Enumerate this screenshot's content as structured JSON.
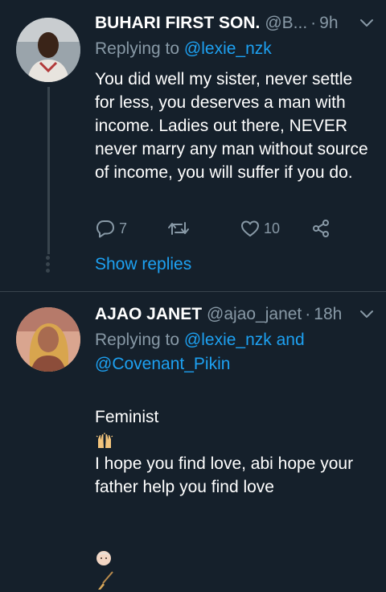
{
  "tweets": [
    {
      "name": "BUHARI FIRST SON.",
      "handle": "@B...",
      "separator": "·",
      "time": "9h",
      "replying_label": "Replying to ",
      "replying_to": "@lexie_nzk",
      "text": "You did well my sister, never settle for less,  you deserves a man with income. Ladies out there,  NEVER never marry any man without source of income, you will suffer if you do.",
      "reply_count": "7",
      "like_count": "10",
      "show_replies": "Show replies",
      "avatar_icon": "person-avatar"
    },
    {
      "name": "AJAO JANET",
      "handle": "@ajao_janet",
      "separator": "·",
      "time": "18h",
      "replying_label": "Replying to ",
      "replying_to": "@lexie_nzk and",
      "replying_to_2": "@Covenant_Pikin",
      "text_part1": "Feminist",
      "text_part2": " I hope you find love, abi hope your father help you find love",
      "emoji_1": "raised-hands-emoji",
      "emoji_2": "face-and-broom-emoji",
      "avatar_icon": "person-avatar"
    }
  ],
  "colors": {
    "background": "#15202b",
    "text": "#ffffff",
    "secondary": "#8899a6",
    "link": "#1da1f2",
    "border": "#38444d"
  }
}
